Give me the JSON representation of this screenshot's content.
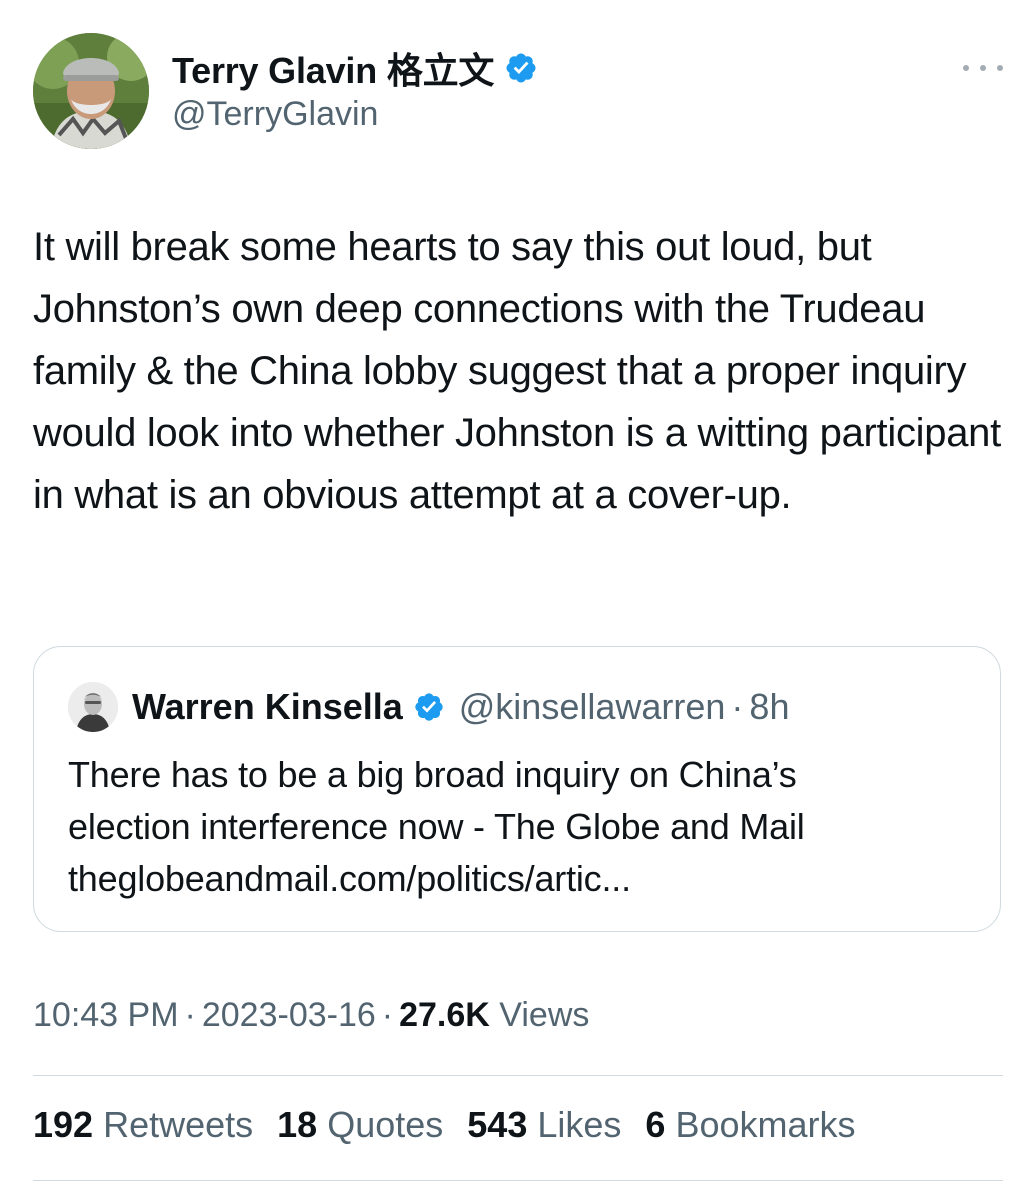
{
  "tweet": {
    "author": {
      "display_name": "Terry Glavin 格立文",
      "handle": "@TerryGlavin",
      "verified": true
    },
    "text": "It will break some hearts to say this out loud, but Johnston’s own deep connections with the Trudeau family & the China lobby suggest that a proper inquiry would look into whether Johnston is a witting participant in what is an obvious attempt at a cover-up.",
    "more_icon": "more-horizontal-icon"
  },
  "quoted_tweet": {
    "author": {
      "display_name": "Warren Kinsella",
      "handle": "@kinsellawarren",
      "verified": true
    },
    "separator": "·",
    "time": "8h",
    "text_line1": "There has to be a big broad inquiry on China’s",
    "text_line2": "election interference now - The Globe and Mail",
    "link": "theglobeandmail.com/politics/artic..."
  },
  "meta": {
    "time": "10:43 PM",
    "separator": "·",
    "date": "2023-03-16",
    "views_count": "27.6K",
    "views_label": "Views"
  },
  "stats": [
    {
      "count": "192",
      "label": "Retweets"
    },
    {
      "count": "18",
      "label": "Quotes"
    },
    {
      "count": "543",
      "label": "Likes"
    },
    {
      "count": "6",
      "label": "Bookmarks"
    }
  ],
  "colors": {
    "text": "#0f1419",
    "secondary": "#536471",
    "verified_blue": "#1d9bf0",
    "border": "#cfd9de"
  }
}
